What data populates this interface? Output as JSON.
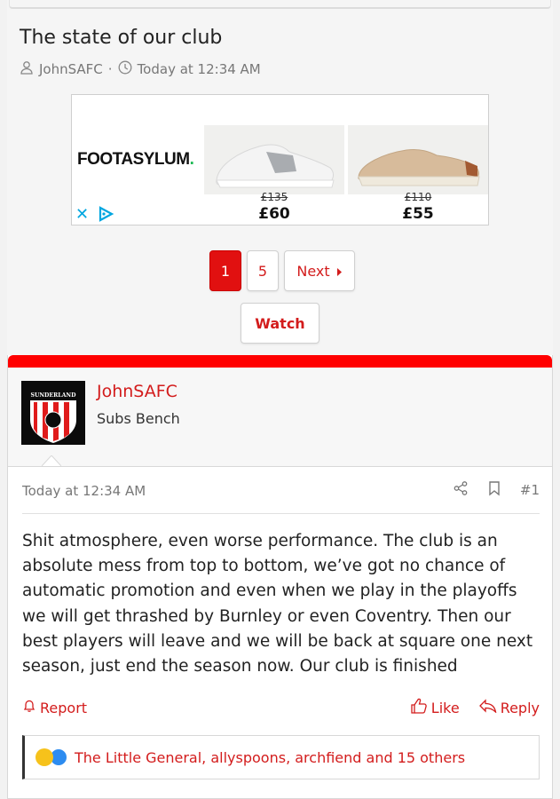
{
  "thread": {
    "title": "The state of our club",
    "author": "JohnSAFC",
    "separator": "·",
    "time": "Today at 12:34 AM"
  },
  "ad": {
    "logo": "FOOTASYLUM",
    "logo_dot": ".",
    "products": [
      {
        "old_price": "£135",
        "new_price": "£60"
      },
      {
        "old_price": "£110",
        "new_price": "£55"
      }
    ],
    "close_icon": "close-icon",
    "adchoices_icon": "adchoices-icon"
  },
  "pagination": {
    "pages": [
      "1",
      "5"
    ],
    "current": "1",
    "next_label": "Next",
    "next_icon": "caret-right-icon"
  },
  "watch_label": "Watch",
  "post": {
    "username": "JohnSAFC",
    "user_title": "Subs Bench",
    "avatar_text": "SUNDERLAND",
    "date": "Today at 12:34 AM",
    "number": "#1",
    "body_lines": [
      "Shit atmosphere, even worse performance. The club is an",
      "absolute mess from top to bottom, we’ve got no chance of",
      "automatic promotion and even when we play in the playoffs",
      "we will get thrashed by Burnley or even Coventry. Then our",
      "best players will leave and we will be back at square one next",
      "season, just end the season now. Our club is finished"
    ],
    "report_label": "Report",
    "like_label": "Like",
    "reply_label": "Reply",
    "reactions_text": "The Little General, allyspoons, archfiend and 15 others"
  },
  "colors": {
    "accent_red": "#d31c1c",
    "bar_red": "#ff0000",
    "active_page": "#e11010"
  }
}
